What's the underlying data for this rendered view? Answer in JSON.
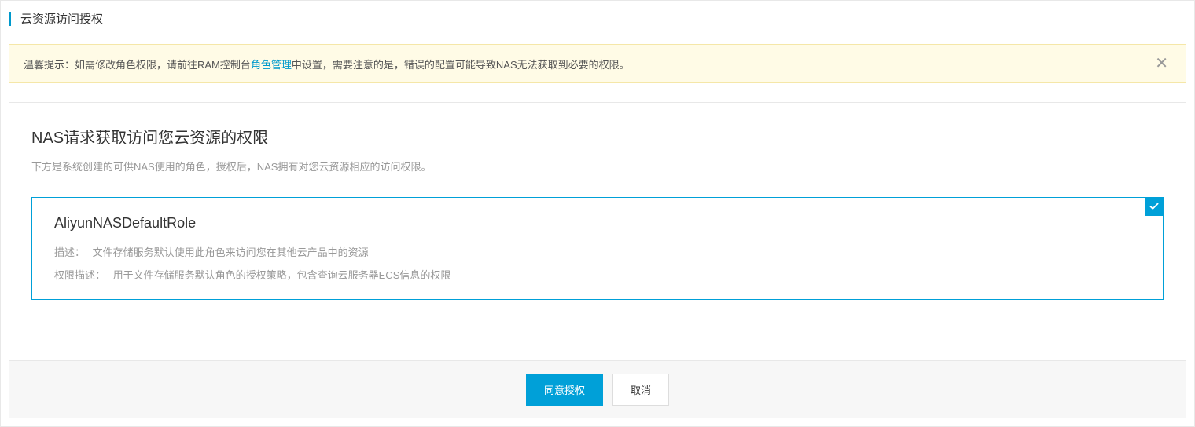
{
  "header": {
    "title": "云资源访问授权"
  },
  "alert": {
    "prefix": "温馨提示：如需修改角色权限，请前往RAM控制台",
    "link_text": "角色管理",
    "suffix": "中设置，需要注意的是，错误的配置可能导致NAS无法获取到必要的权限。"
  },
  "content": {
    "title": "NAS请求获取访问您云资源的权限",
    "subtitle": "下方是系统创建的可供NAS使用的角色，授权后，NAS拥有对您云资源相应的访问权限。"
  },
  "role": {
    "name": "AliyunNASDefaultRole",
    "desc_label": "描述：",
    "desc_value": "文件存储服务默认使用此角色来访问您在其他云产品中的资源",
    "perm_label": "权限描述：",
    "perm_value": "用于文件存储服务默认角色的授权策略，包含查询云服务器ECS信息的权限"
  },
  "footer": {
    "agree": "同意授权",
    "cancel": "取消"
  }
}
